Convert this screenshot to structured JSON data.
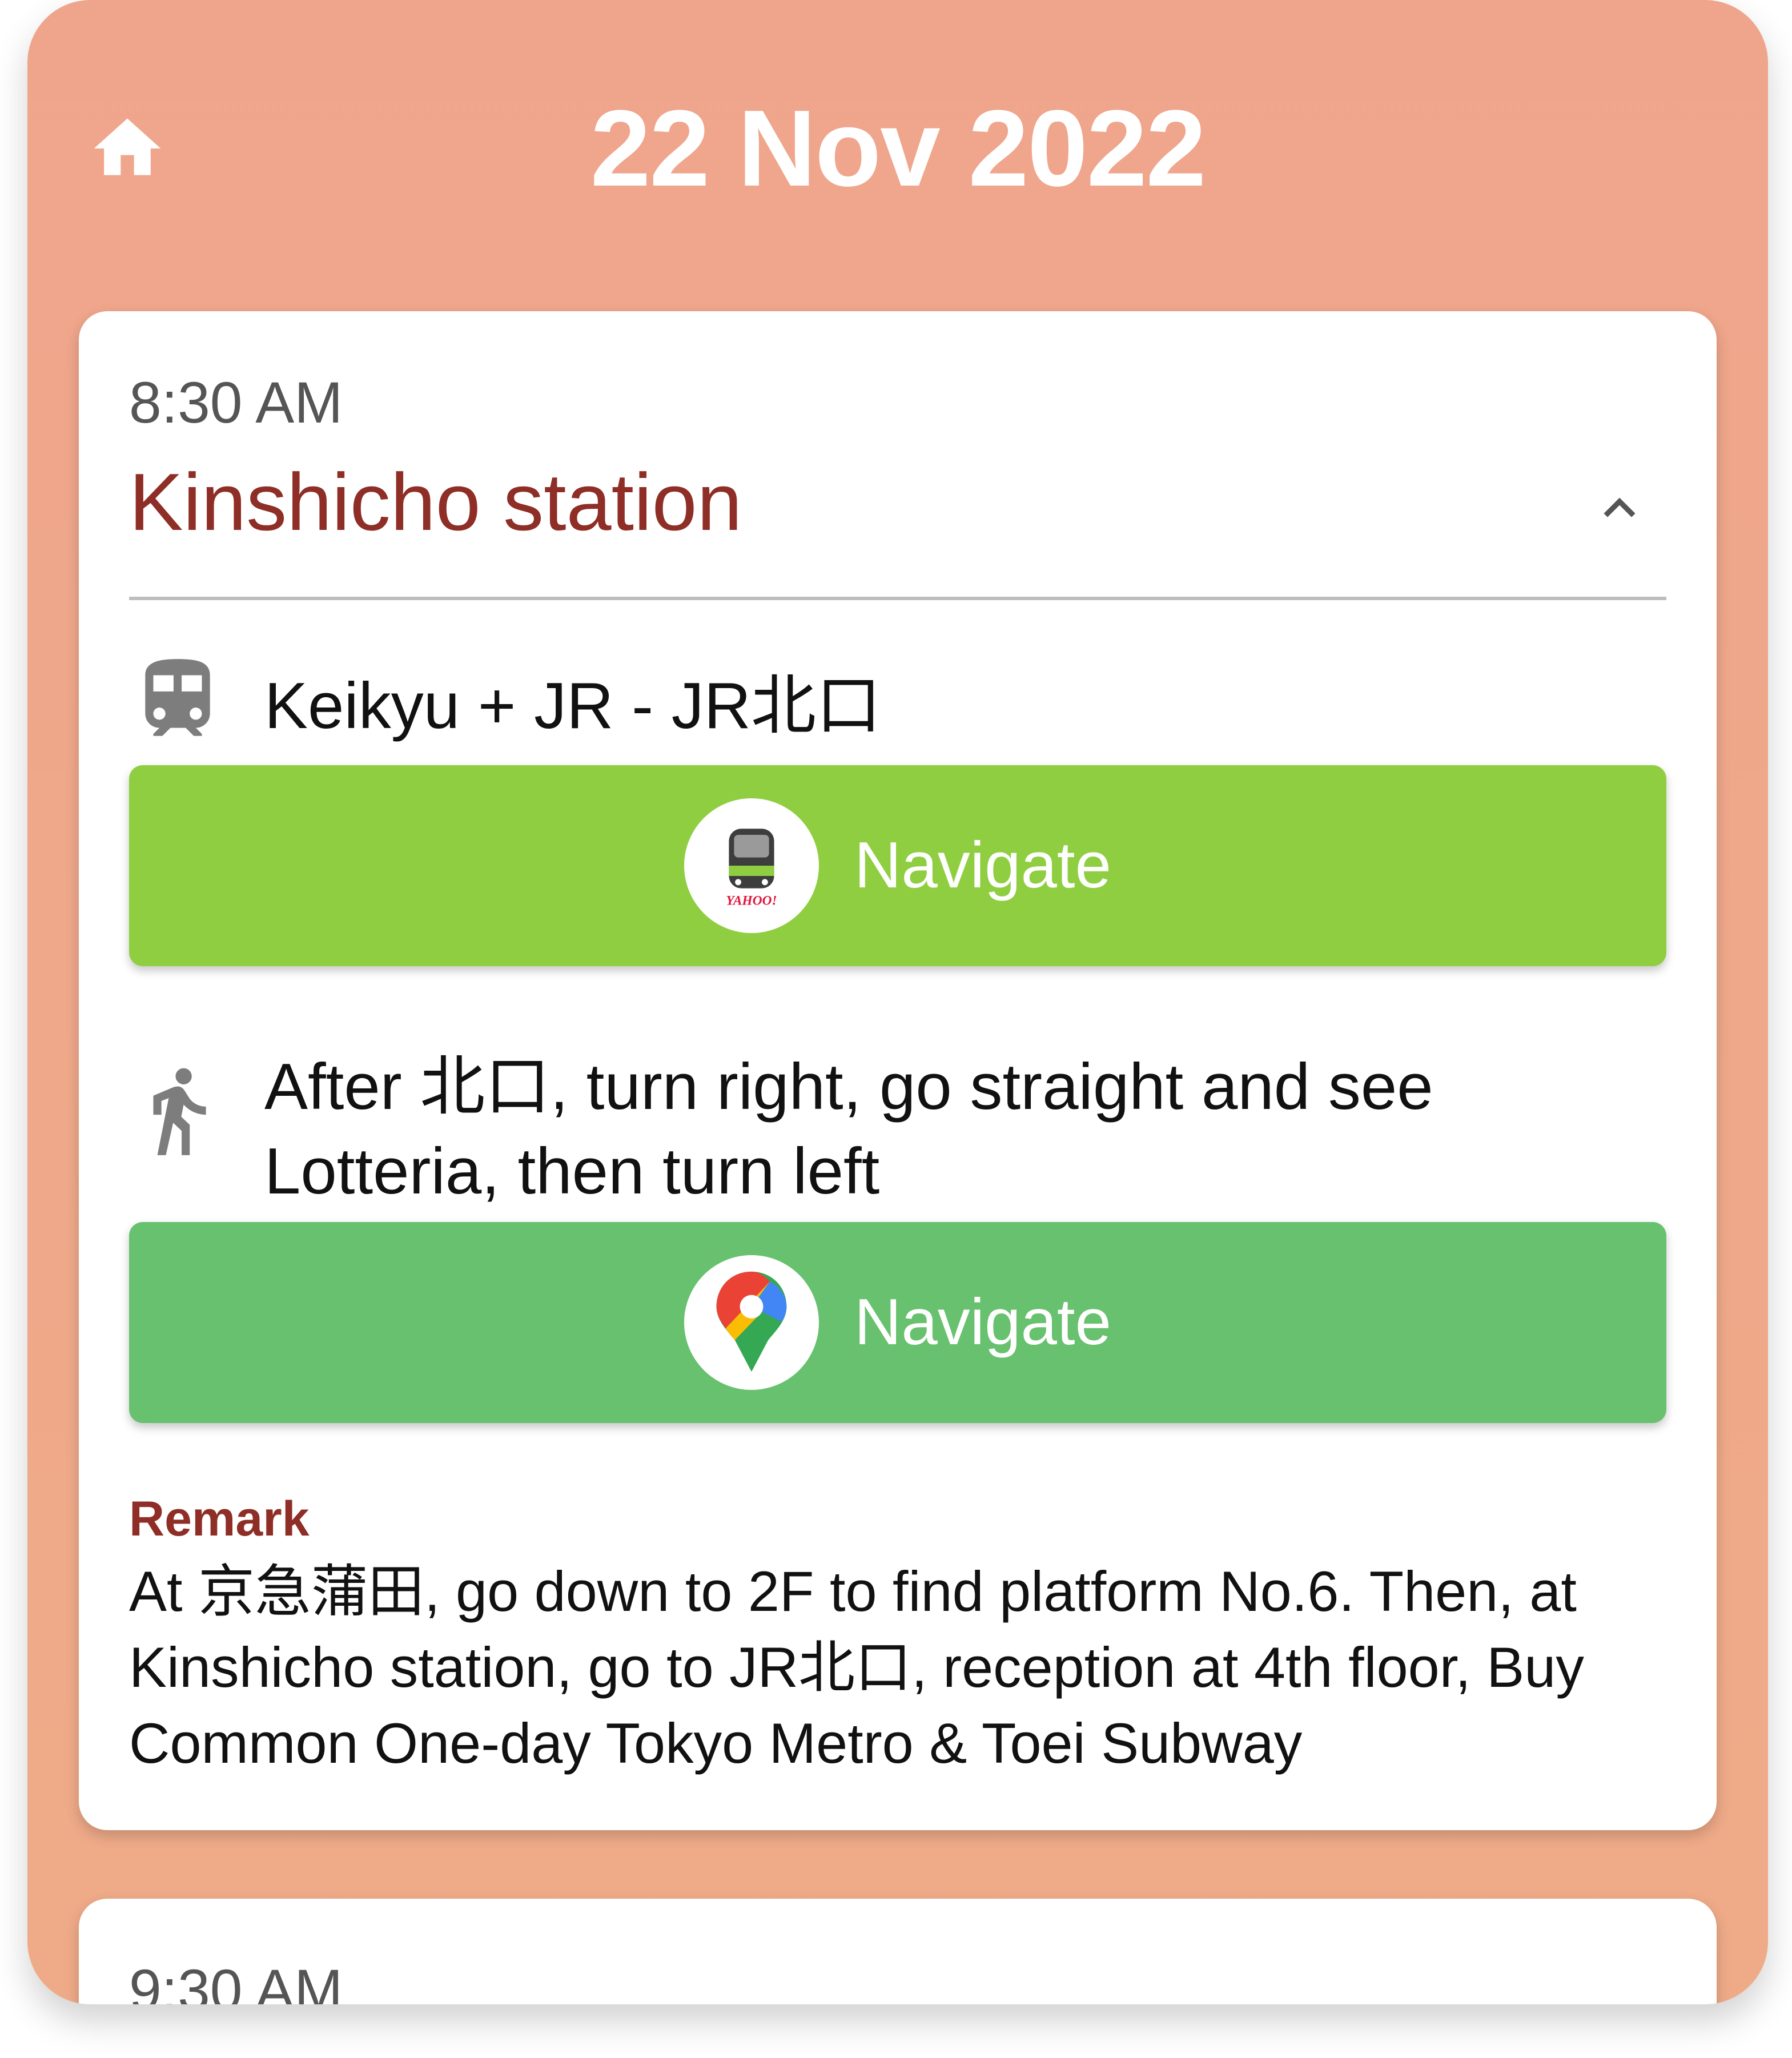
{
  "header": {
    "date_title": "22 Nov 2022",
    "home_icon": "home-icon"
  },
  "colors": {
    "background": "#EFA58C",
    "place_title": "#8E2E26",
    "train_button": "#8FCE41",
    "maps_button": "#68C16E"
  },
  "cards": [
    {
      "time": "8:30 AM",
      "place": "Kinshicho station",
      "collapse_icon": "chevron-up-icon",
      "steps": [
        {
          "icon": "train-icon",
          "text": "Keikyu + JR - JR北口",
          "button": {
            "logo": "yahoo-transit-logo",
            "label": "Navigate"
          }
        },
        {
          "icon": "walking-icon",
          "text": "After 北口, turn right, go straight and see Lotteria, then turn left",
          "button": {
            "logo": "google-maps-logo",
            "label": "Navigate"
          }
        }
      ],
      "remark_title": "Remark",
      "remark_text": "At 京急蒲田, go down to 2F to find platform No.6. Then, at Kinshicho station, go to JR北口, reception at 4th floor, Buy Common One-day Tokyo Metro & Toei Subway"
    },
    {
      "time": "9:30 AM"
    }
  ]
}
